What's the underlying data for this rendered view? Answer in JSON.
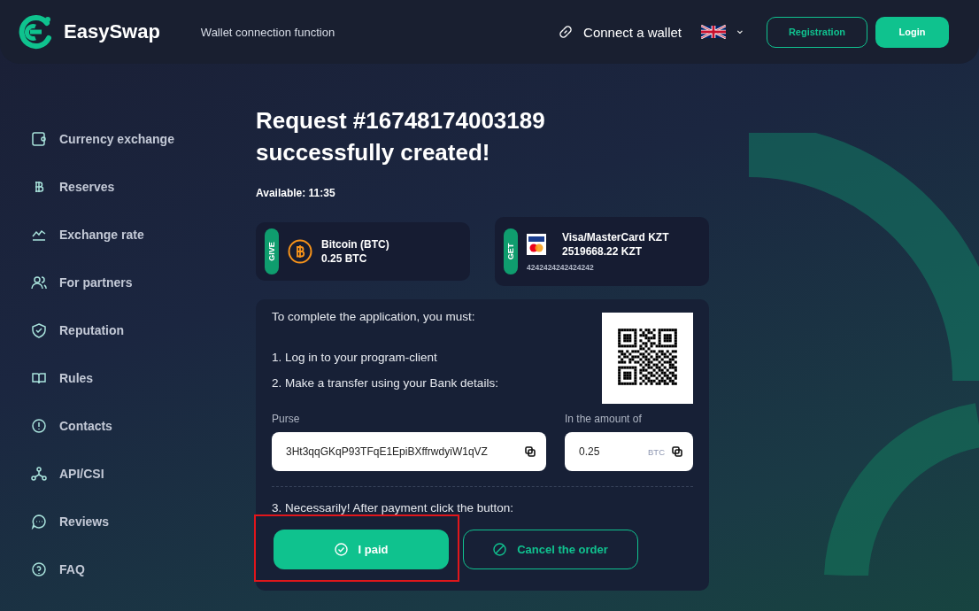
{
  "header": {
    "logo": "EasySwap",
    "tagline": "Wallet connection function",
    "connect": "Connect a wallet",
    "language_caret": "⌄",
    "registration": "Registration",
    "login": "Login"
  },
  "sidebar": {
    "items": [
      {
        "label": "Currency exchange"
      },
      {
        "label": "Reserves"
      },
      {
        "label": "Exchange rate"
      },
      {
        "label": "For partners"
      },
      {
        "label": "Reputation"
      },
      {
        "label": "Rules"
      },
      {
        "label": "Contacts"
      },
      {
        "label": "API/CSI"
      },
      {
        "label": "Reviews"
      },
      {
        "label": "FAQ"
      }
    ]
  },
  "request": {
    "title_line1": "Request #16748174003189",
    "title_line2": "successfully created!",
    "available": "Available: 11:35"
  },
  "give": {
    "tag": "GIVE",
    "name": "Bitcoin (BTC)",
    "amount": "0.25 BTC"
  },
  "get": {
    "tag": "GET",
    "name": "Visa/MasterCard KZT",
    "amount": "2519668.22 KZT",
    "card": "4242424242424242"
  },
  "instructions": {
    "intro": "To complete the application, you must:",
    "step1": "1. Log in to your program-client",
    "step2": "2. Make a transfer using your Bank details:",
    "purse_label": "Purse",
    "purse_value": "3Ht3qqGKqP93TFqE1EpiBXffrwdyiW1qVZ",
    "amount_label": "In the amount of",
    "amount_value": "0.25",
    "amount_unit": "BTC",
    "step3": "3. Necessarily! After payment click the button:"
  },
  "actions": {
    "paid": "I paid",
    "paid_highlighted": true,
    "cancel": "Cancel the order"
  }
}
